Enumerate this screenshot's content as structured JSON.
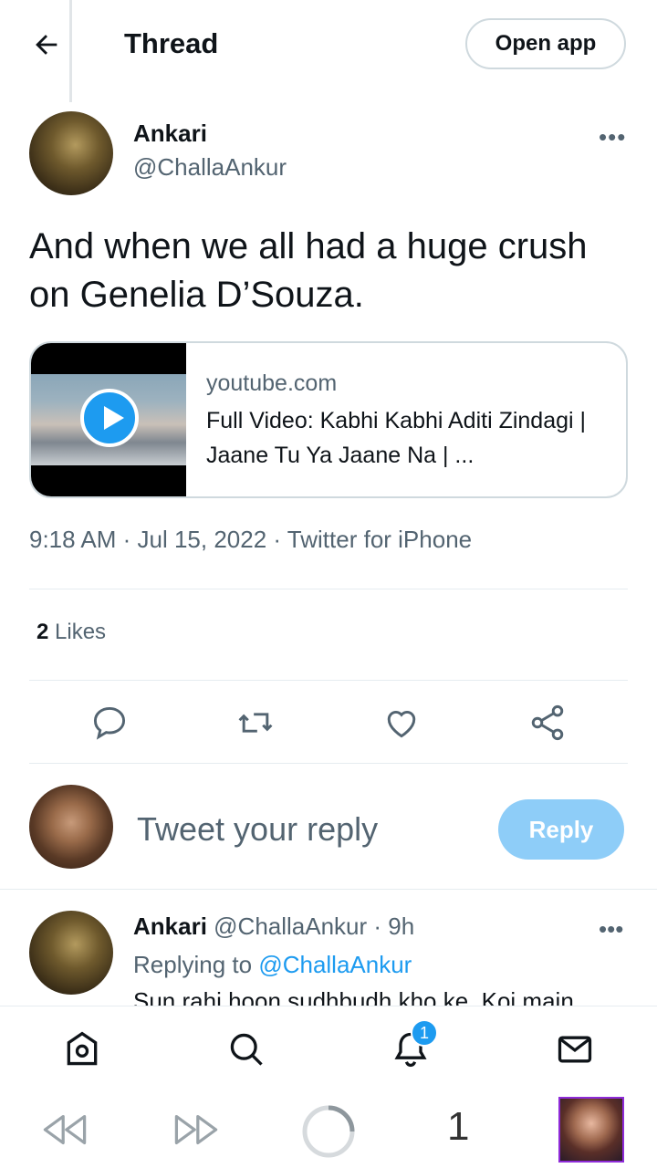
{
  "header": {
    "title": "Thread",
    "open_app_label": "Open app"
  },
  "tweet": {
    "author_name": "Ankari",
    "author_handle": "@ChallaAnkur",
    "text": "And when we all had a huge crush on Genelia D’Souza.",
    "card": {
      "site": "youtube.com",
      "title": "Full Video: Kabhi Kabhi Aditi Zindagi | Jaane Tu Ya Jaane Na | ..."
    },
    "meta": "9:18 AM · Jul 15, 2022 · Twitter for iPhone",
    "likes_count": "2",
    "likes_label": "Likes"
  },
  "reply_box": {
    "placeholder": "Tweet your reply",
    "button_label": "Reply"
  },
  "comment": {
    "author_name": "Ankari",
    "author_handle_time": "@ChallaAnkur · 9h",
    "replying_prefix": "Replying to",
    "replying_to": "@ChallaAnkur",
    "text": "Sun rahi hoon sudhbudh kho ke, Koi main"
  },
  "bottom_nav": {
    "items": [
      "home-icon",
      "search-icon",
      "notifications-icon",
      "messages-icon"
    ],
    "notification_badge": "1"
  },
  "browser_bar": {
    "tab_count": "1"
  },
  "colors": {
    "accent": "#1d9bf0",
    "reply_button_disabled": "#8ecdf8",
    "secondary_text": "#536471"
  }
}
